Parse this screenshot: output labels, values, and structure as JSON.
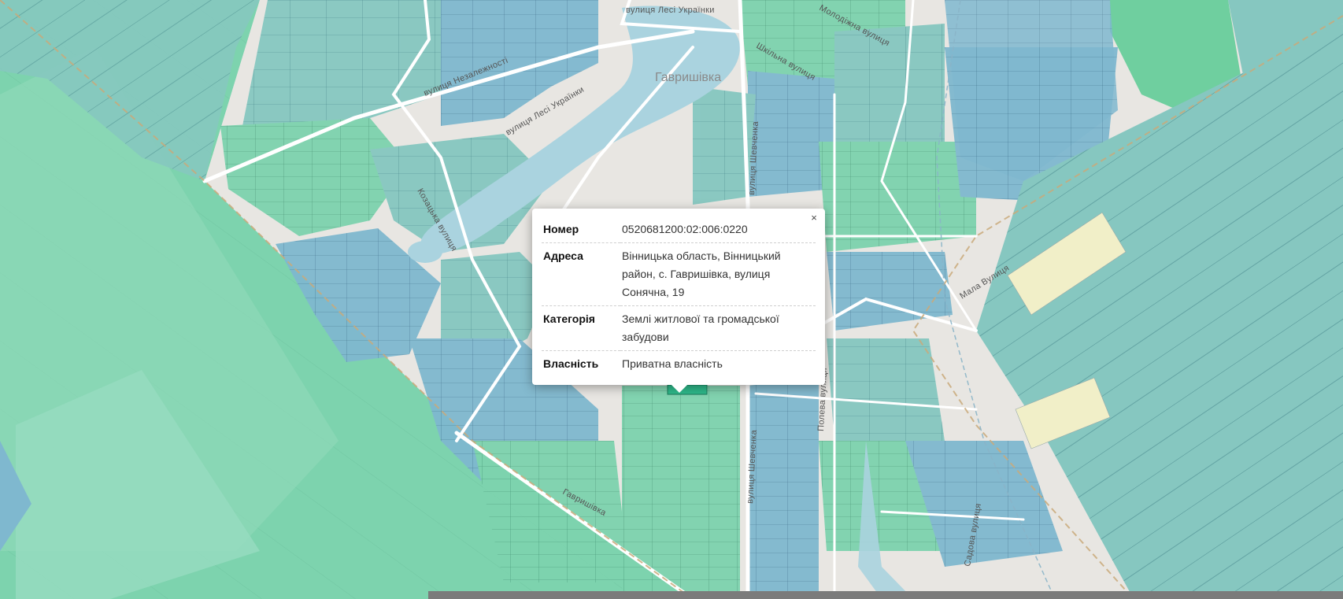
{
  "map": {
    "place_label": "Гавришівка",
    "street_labels": [
      "вулиця Лесі Українки",
      "вулиця Незалежності",
      "вулиця Лесі Українки",
      "Козацька вулиця",
      "вулиця Шевченка",
      "вулиця Шевченка",
      "Полева вулиця",
      "Гавришівка",
      "Садова вулиця",
      "Мала Вулиця",
      "Шкільна вулиця",
      "Молодіжна вулиця"
    ],
    "colors": {
      "parcel_green": "#7dd3ae",
      "parcel_blue": "#7fb8cf",
      "parcel_teal": "#86c7c0",
      "parcel_yellow": "#f1efc8",
      "selected_parcel": "#2eb98a",
      "road": "#ffffff",
      "base": "#e8e6e2",
      "water": "#aad3df"
    }
  },
  "popup": {
    "close_label": "×",
    "rows": [
      {
        "key": "Номер",
        "value": "0520681200:02:006:0220"
      },
      {
        "key": "Адреса",
        "value": "Вінницька область, Вінницький район, с. Гавришівка, вулиця Сонячна, 19"
      },
      {
        "key": "Категорія",
        "value": "Землі житлової та громадської забудови"
      },
      {
        "key": "Власність",
        "value": "Приватна власність"
      }
    ]
  }
}
